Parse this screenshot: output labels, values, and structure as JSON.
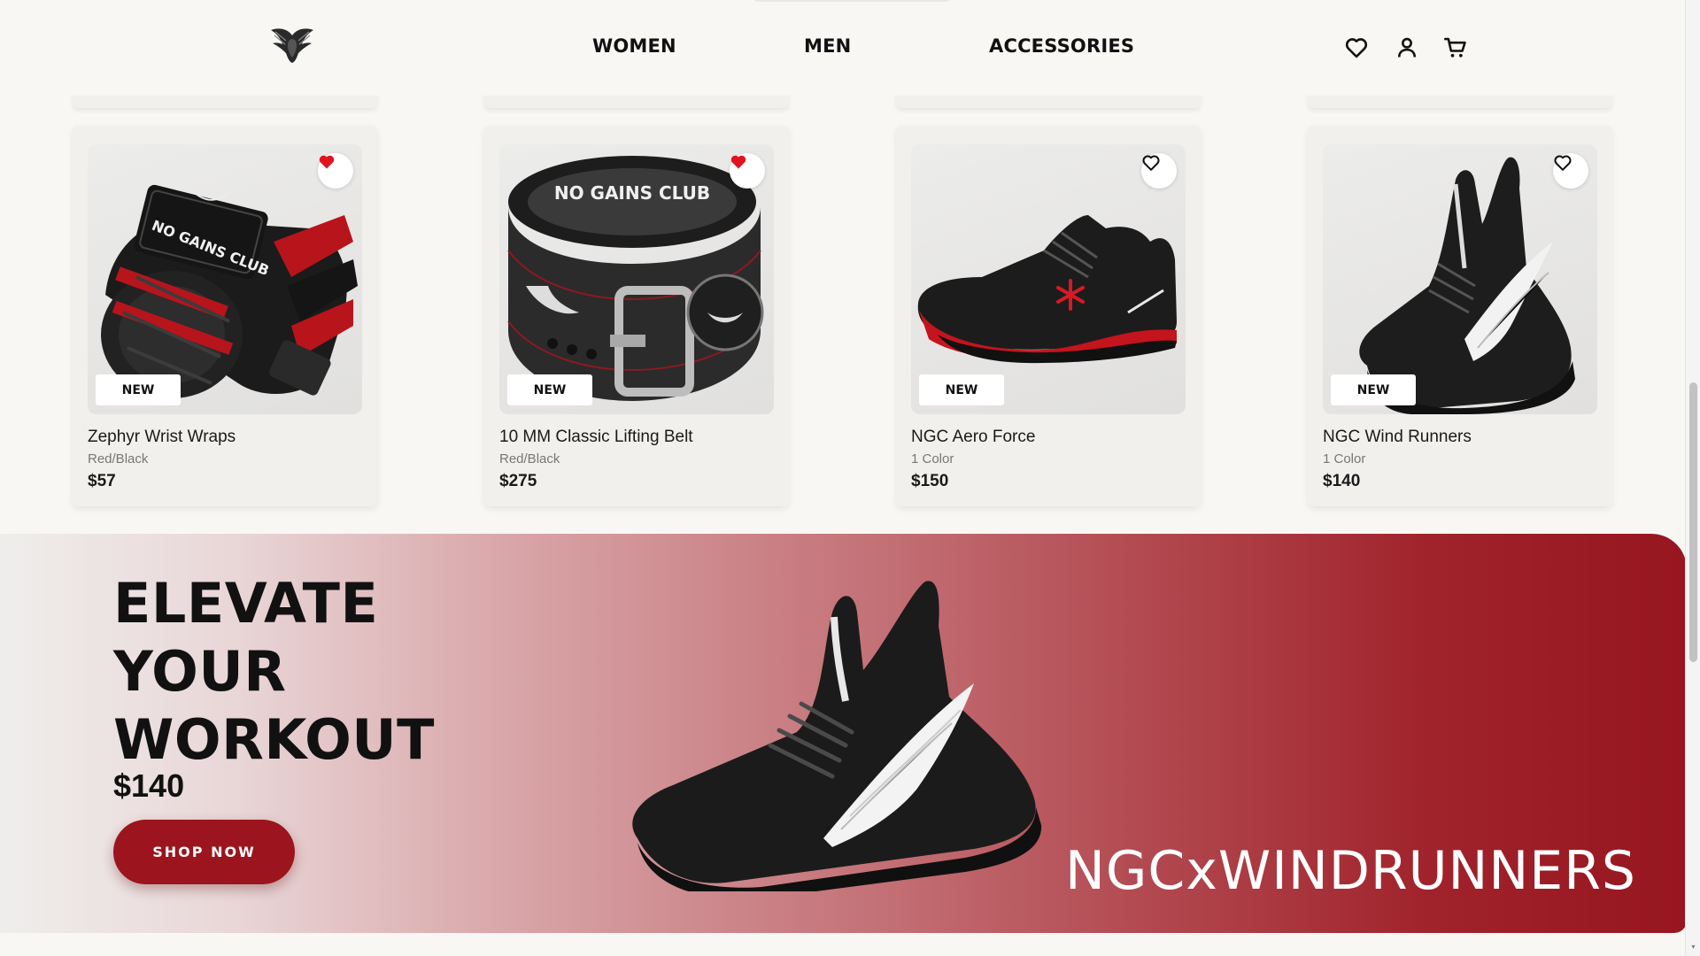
{
  "nav": {
    "items": [
      {
        "label": "WOMEN"
      },
      {
        "label": "MEN"
      },
      {
        "label": "ACCESSORIES"
      }
    ],
    "icons": [
      "heart-icon",
      "user-icon",
      "cart-icon"
    ]
  },
  "products": [
    {
      "name": "Zephyr Wrist Wraps",
      "variant": "Red/Black",
      "price": "$57",
      "badge": "NEW",
      "favorited": true
    },
    {
      "name": "10 MM Classic Lifting Belt",
      "variant": "Red/Black",
      "price": "$275",
      "badge": "NEW",
      "favorited": true
    },
    {
      "name": "NGC Aero Force",
      "variant": "1 Color",
      "price": "$150",
      "badge": "NEW",
      "favorited": false
    },
    {
      "name": "NGC Wind Runners",
      "variant": "1 Color",
      "price": "$140",
      "badge": "NEW",
      "favorited": false
    }
  ],
  "product_image_text": {
    "wraps": "NO GAINS CLUB",
    "belt": "NO GAINS CLUB"
  },
  "hero": {
    "title_lines": [
      "ELEVATE",
      "YOUR",
      "WORKOUT"
    ],
    "price": "$140",
    "cta_label": "SHOP NOW",
    "collection": "NGCxWINDRUNNERS"
  },
  "colors": {
    "accent": "#9c141d",
    "favorite": "#e0141e",
    "background": "#f8f7f4"
  }
}
